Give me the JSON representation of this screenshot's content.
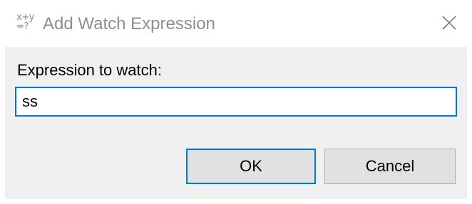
{
  "dialog": {
    "title": "Add Watch Expression",
    "icon": {
      "name": "watch-expression-icon",
      "glyph_top": "x+y",
      "glyph_bottom": "=?"
    },
    "close_icon": "close-icon"
  },
  "form": {
    "label": "Expression to watch:",
    "expression_value": "ss"
  },
  "buttons": {
    "ok_label": "OK",
    "cancel_label": "Cancel"
  },
  "colors": {
    "focus_accent": "#0078d7",
    "content_background": "#f0f0f0",
    "button_background": "#e1e1e1",
    "title_text": "#8e8e8e"
  }
}
